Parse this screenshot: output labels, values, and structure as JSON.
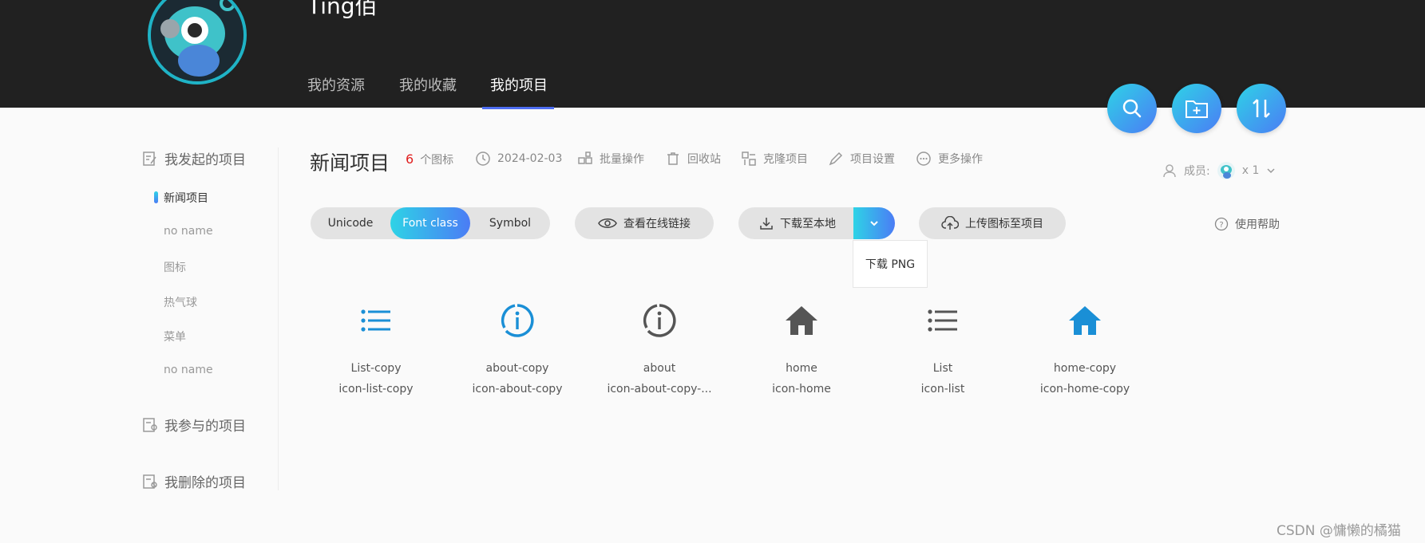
{
  "header": {
    "user_name": "Ting佰",
    "tabs": [
      {
        "label": "我的资源"
      },
      {
        "label": "我的收藏"
      },
      {
        "label": "我的项目"
      }
    ]
  },
  "sidebar": {
    "group_started": "我发起的项目",
    "items": [
      "新闻项目",
      "no name",
      "图标",
      "热气球",
      "菜单",
      "no name"
    ],
    "group_joined": "我参与的项目",
    "group_deleted": "我删除的项目"
  },
  "project": {
    "title": "新闻项目",
    "icon_count": "6",
    "icon_count_unit": "个图标",
    "date": "2024-02-03",
    "batch": "批量操作",
    "recycle": "回收站",
    "clone": "克隆项目",
    "settings": "项目设置",
    "more": "更多操作",
    "members_label": "成员:",
    "members_count": "x 1"
  },
  "toolbar": {
    "modes": [
      "Unicode",
      "Font class",
      "Symbol"
    ],
    "active_mode": "Font class",
    "view_link": "查看在线链接",
    "download": "下载至本地",
    "download_png": "下载 PNG",
    "upload": "上传图标至项目",
    "help": "使用帮助"
  },
  "icons": [
    {
      "name": "List-copy",
      "class": "icon-list-copy",
      "icon": "list-icon",
      "color": "#1a8fd6"
    },
    {
      "name": "about-copy",
      "class": "icon-about-copy",
      "icon": "info-icon",
      "color": "#1a8fd6"
    },
    {
      "name": "about",
      "class": "icon-about-copy-...",
      "icon": "info-icon",
      "color": "#555555"
    },
    {
      "name": "home",
      "class": "icon-home",
      "icon": "home-icon",
      "color": "#555555"
    },
    {
      "name": "List",
      "class": "icon-list",
      "icon": "list-icon",
      "color": "#555555"
    },
    {
      "name": "home-copy",
      "class": "icon-home-copy",
      "icon": "home-icon",
      "color": "#1a8fd6"
    }
  ],
  "watermark": "CSDN @慵懒的橘猫",
  "colors": {
    "accent_start": "#2ed3e6",
    "accent_end": "#4b7cf5",
    "header_bg": "#212121",
    "count_red": "#e02020"
  }
}
